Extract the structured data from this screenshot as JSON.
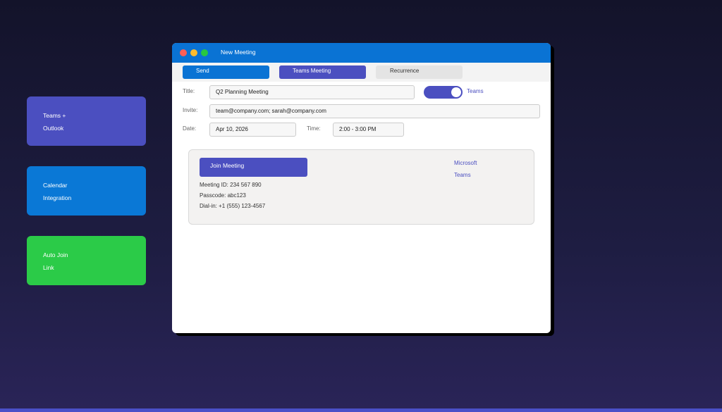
{
  "features": [
    {
      "line1": "Teams +",
      "line2": "Outlook"
    },
    {
      "line1": "Calendar",
      "line2": "Integration"
    },
    {
      "line1": "Auto Join",
      "line2": "Link"
    }
  ],
  "window": {
    "title": "New Meeting"
  },
  "toolbar": {
    "send": "Send",
    "teams_meeting": "Teams Meeting",
    "recurrence": "Recurrence"
  },
  "form": {
    "title_label": "Title:",
    "title_value": "Q2 Planning Meeting",
    "teams_toggle_label": "Teams",
    "teams_toggle_on": true,
    "invite_label": "Invite:",
    "invite_value": "team@company.com; sarah@company.com",
    "date_label": "Date:",
    "date_value": "Apr 10, 2026",
    "time_label": "Time:",
    "time_value": "2:00 - 3:00 PM"
  },
  "meeting": {
    "join_label": "Join Meeting",
    "meeting_id": "Meeting ID: 234 567 890",
    "passcode": "Passcode: abc123",
    "dial_in": "Dial-in: +1 (555) 123-4567",
    "brand_line1": "Microsoft",
    "brand_line2": "Teams"
  },
  "colors": {
    "accent_blue": "#0a73d4",
    "teams_purple": "#4b4fc0",
    "green": "#2bcb48"
  }
}
